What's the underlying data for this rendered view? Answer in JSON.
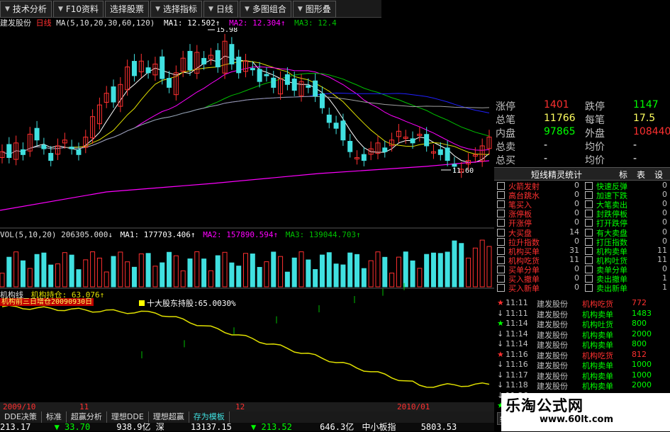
{
  "menu": [
    {
      "label": "技术分析",
      "arrow": true
    },
    {
      "label": "F10资料",
      "arrow": true
    },
    {
      "label": "选择股票",
      "arrow": false
    },
    {
      "label": "选择指标",
      "arrow": true
    },
    {
      "label": "日线",
      "arrow": true
    },
    {
      "label": "多图组合",
      "arrow": true
    },
    {
      "label": "图形叠",
      "arrow": true
    }
  ],
  "title": {
    "stock": "建发股份",
    "period": "日线",
    "ma_label": "MA(5,10,20,30,60,120)",
    "ma1": "MA1: 12.502↑",
    "ma2": "MA2: 12.304↑",
    "ma3": "MA3: 12.4"
  },
  "price_labels": {
    "high": "15.98",
    "low": "11.60"
  },
  "volume": {
    "header": "VOL(5,10,20)",
    "value": "206305.000↓",
    "ma1": "MA1: 177703.406↑",
    "ma2": "MA2: 157890.594↑",
    "ma3": "MA3: 139044.703↑"
  },
  "institution": {
    "header": "机构线",
    "hold_label": "机构持仓: 63.076↑",
    "flag_text": "机构前三日增仓",
    "flag_date": "20090930日",
    "shareholder_note": "十大股东持股:65.0030%"
  },
  "dates": {
    "left": "2009/10",
    "mid1": "11",
    "mid2": "12",
    "right": "2010/01"
  },
  "bottom_tabs": [
    "DDE决策",
    "标准",
    "超赢分析",
    "理想DDE",
    "理想超赢",
    "存为模板"
  ],
  "statusbar": {
    "v1": "213.17",
    "v2": "▼ 33.70",
    "v3": "938.9亿",
    "v4": "深",
    "v5": "13137.15",
    "v6": "▼ 213.52",
    "v7": "646.3亿",
    "v8": "中小板指",
    "v9": "5803.53"
  },
  "quote": {
    "zhangting_label": "涨停",
    "zhangting": "1401",
    "dieting_label": "跌停",
    "dieting": "1147",
    "zongbi_label": "总笔",
    "zongbi": "11766",
    "meibi_label": "每笔",
    "meibi": "17.5",
    "neipan_label": "内盘",
    "neipan": "97865",
    "waipan_label": "外盘",
    "waipan": "108440",
    "zongmai_label": "总卖",
    "zongmai": "-",
    "junjia1_label": "均价",
    "junjia1": "-",
    "zongmai2_label": "总买",
    "zongmai2": "-",
    "junjia2_label": "均价",
    "junjia2": "-"
  },
  "stats_title": "短线精灵统计",
  "stats_tabs": [
    "标",
    "表",
    "设"
  ],
  "signals": [
    {
      "left": "火箭发射",
      "lv": "0",
      "right": "快速反弹",
      "rv": "0"
    },
    {
      "left": "高台跳水",
      "lv": "0",
      "right": "加速下跌",
      "rv": "0"
    },
    {
      "left": "笔买入",
      "lv": "0",
      "right": "大笔卖出",
      "rv": "0"
    },
    {
      "left": "涨停板",
      "lv": "0",
      "right": "封跌停板",
      "rv": "0"
    },
    {
      "left": "开涨停",
      "lv": "0",
      "right": "打开跌停",
      "rv": "0"
    },
    {
      "left": "大买盘",
      "lv": "14",
      "right": "有大卖盘",
      "rv": "0"
    },
    {
      "left": "拉升指数",
      "lv": "0",
      "right": "打压指数",
      "rv": "0"
    },
    {
      "left": "机构买单",
      "lv": "31",
      "right": "机构卖单",
      "rv": "11"
    },
    {
      "left": "机构吃货",
      "lv": "11",
      "right": "机构吐货",
      "rv": "11"
    },
    {
      "left": "买单分单",
      "lv": "0",
      "right": "卖单分单",
      "rv": "0"
    },
    {
      "left": "买入撤单",
      "lv": "0",
      "right": "卖出撤单",
      "rv": "1"
    },
    {
      "left": "买入新单",
      "lv": "0",
      "right": "卖出新单",
      "rv": "1"
    }
  ],
  "ticks": [
    {
      "mark": "★",
      "time": "11:11",
      "stock": "建发股份",
      "action": "机构吃货",
      "val": "772",
      "color": "#ff3030"
    },
    {
      "mark": "↓",
      "time": "11:11",
      "stock": "建发股份",
      "action": "机构卖单",
      "val": "1483",
      "color": "#00ff00"
    },
    {
      "mark": "★",
      "time": "11:14",
      "stock": "建发股份",
      "action": "机构吐货",
      "val": "800",
      "color": "#00ff00"
    },
    {
      "mark": "↓",
      "time": "11:14",
      "stock": "建发股份",
      "action": "机构卖单",
      "val": "2000",
      "color": "#00ff00"
    },
    {
      "mark": "↓",
      "time": "11:14",
      "stock": "建发股份",
      "action": "机构卖单",
      "val": "800",
      "color": "#00ff00"
    },
    {
      "mark": "★",
      "time": "11:16",
      "stock": "建发股份",
      "action": "机构吃货",
      "val": "812",
      "color": "#ff3030"
    },
    {
      "mark": "↓",
      "time": "11:16",
      "stock": "建发股份",
      "action": "机构卖单",
      "val": "1000",
      "color": "#00ff00"
    },
    {
      "mark": "↓",
      "time": "11:17",
      "stock": "建发股份",
      "action": "机构卖单",
      "val": "1000",
      "color": "#00ff00"
    },
    {
      "mark": "↓",
      "time": "11:18",
      "stock": "建发股份",
      "action": "机构卖单",
      "val": "2000",
      "color": "#00ff00"
    },
    {
      "mark": "↓",
      "time": "11:26",
      "stock": "",
      "action": "",
      "val": "",
      "color": "#00ff00"
    },
    {
      "mark": "★",
      "time": "11:26",
      "stock": "",
      "action": "",
      "val": "",
      "color": "#00ff00"
    }
  ],
  "side_tabs": [
    "细",
    "逐"
  ],
  "watermark": {
    "title": "乐淘公式网",
    "url": "www.60lt.com"
  },
  "colors": {
    "up": "#ff3030",
    "down": "#40e0e0",
    "ma_white": "#ffffff",
    "ma_yellow": "#e0e000",
    "ma_magenta": "#ff00ff",
    "ma_green": "#00c000",
    "ma_blue": "#2020ff",
    "ma_gray": "#a0a0a0"
  }
}
